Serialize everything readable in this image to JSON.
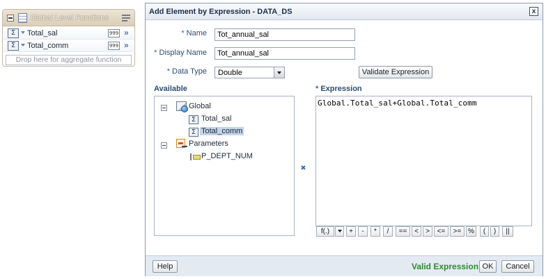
{
  "left_panel": {
    "title": "Global Level Functions",
    "items": [
      {
        "symbol": "Σ",
        "label": "Total_sal",
        "format": "999",
        "action": "»"
      },
      {
        "symbol": "Σ",
        "label": "Total_comm",
        "format": "999",
        "action": "»"
      }
    ],
    "drop_zone": "Drop here for aggregate function"
  },
  "dialog": {
    "title": "Add Element by Expression - DATA_DS",
    "close": "x",
    "required_marker": "*",
    "name_label": "Name",
    "name_value": "Tot_annual_sal",
    "display_name_label": "Display Name",
    "display_name_value": "Tot_annual_sal",
    "data_type_label": "Data Type",
    "data_type_value": "Double",
    "validate_button": "Validate Expression",
    "available_label": "Available",
    "expression_label": "Expression",
    "tree": {
      "global": "Global",
      "global_items": [
        {
          "symbol": "Σ",
          "label": "Total_sal"
        },
        {
          "symbol": "Σ",
          "label": "Total_comm"
        }
      ],
      "parameters": "Parameters",
      "param_items": [
        "P_DEPT_NUM"
      ]
    },
    "shuttle_icon": "chevron-right-icon",
    "expression_text": "Global.Total_sal+Global.Total_comm",
    "operators": [
      "f(.)",
      "+",
      "-",
      "*",
      "/",
      "==",
      "<",
      ">",
      "<=",
      ">=",
      "%",
      "(",
      ")",
      "||"
    ],
    "footer": {
      "help": "Help",
      "valid_message": "Valid Expression",
      "ok": "OK",
      "cancel": "Cancel"
    }
  },
  "colors": {
    "valid": "#2f8a2f",
    "label": "#2c4a70",
    "selection": "#c4d4ea"
  }
}
